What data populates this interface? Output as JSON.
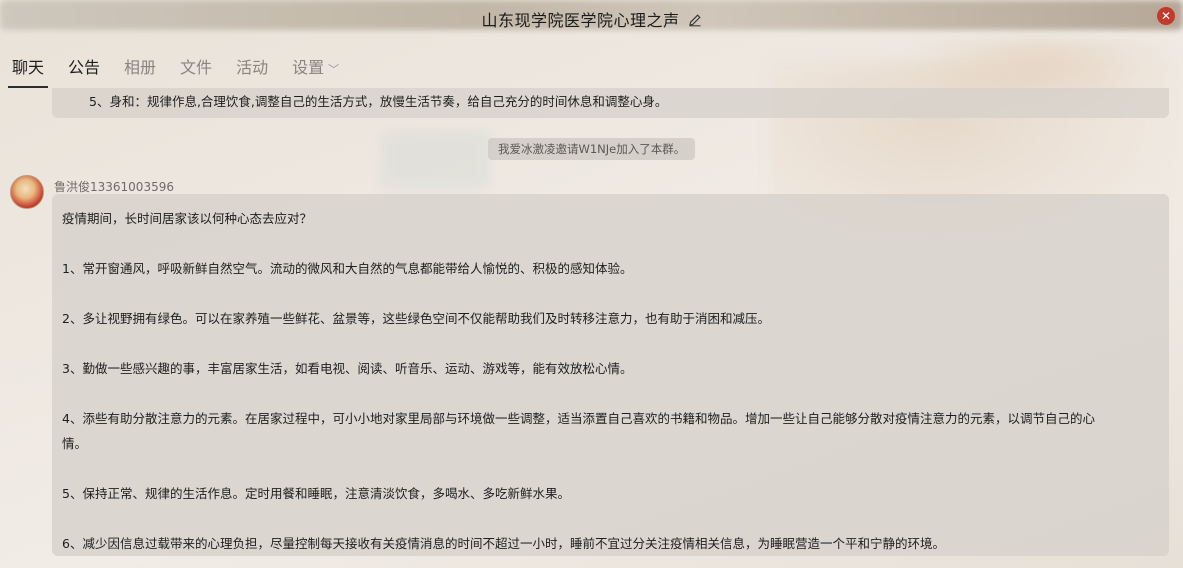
{
  "window": {
    "title": "山东现学院医学院心理之声",
    "edit_icon": "pencil-icon",
    "close_icon": "close-icon",
    "accent": "#c23a2c"
  },
  "tabs": [
    {
      "label": "聊天",
      "active": true
    },
    {
      "label": "公告",
      "active": false
    },
    {
      "label": "相册",
      "active": false
    },
    {
      "label": "文件",
      "active": false
    },
    {
      "label": "活动",
      "active": false
    },
    {
      "label": "设置",
      "active": false,
      "has_dropdown": true
    }
  ],
  "chat": {
    "previous_message_tail": "5、身和：规律作息,合理饮食,调整自己的生活方式，放慢生活节奏，给自己充分的时间休息和调整心身。",
    "system_notice": "我爱冰激凌邀请W1NJe加入了本群。",
    "message": {
      "sender": "鲁洪俊13361003596",
      "lines": [
        "疫情期间，长时间居家该以何种心态去应对？",
        "",
        "1、常开窗通风，呼吸新鲜自然空气。流动的微风和大自然的气息都能带给人愉悦的、积极的感知体验。",
        "",
        "2、多让视野拥有绿色。可以在家养殖一些鲜花、盆景等，这些绿色空间不仅能帮助我们及时转移注意力，也有助于消困和减压。",
        "",
        "3、勤做一些感兴趣的事，丰富居家生活，如看电视、阅读、听音乐、运动、游戏等，能有效放松心情。",
        "",
        "4、添些有助分散注意力的元素。在居家过程中，可小小地对家里局部与环境做一些调整，适当添置自己喜欢的书籍和物品。增加一些让自己能够分散对疫情注意力的元素，以调节自己的心",
        "情。",
        "",
        "5、保持正常、规律的生活作息。定时用餐和睡眠，注意清淡饮食，多喝水、多吃新鲜水果。",
        "",
        "6、减少因信息过载带来的心理负担，尽量控制每天接收有关疫情消息的时间不超过一小时，睡前不宜过分关注疫情相关信息，为睡眠营造一个平和宁静的环境。"
      ]
    }
  }
}
